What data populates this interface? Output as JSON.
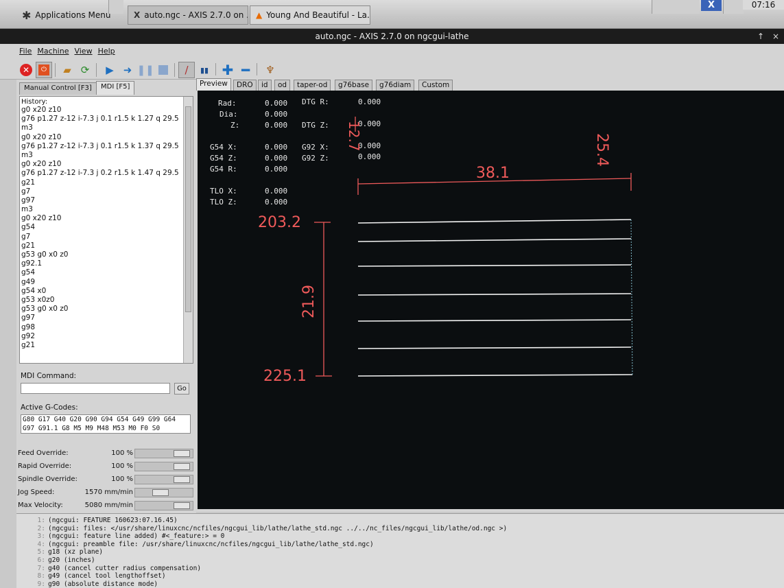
{
  "taskbar": {
    "app_menu": "Applications Menu",
    "tasks": [
      "auto.ngc - AXIS 2.7.0 on ...",
      "Young And Beautiful - La..."
    ],
    "clock": "07:16",
    "tray_badge": "X"
  },
  "window": {
    "title": "auto.ngc - AXIS 2.7.0 on ngcgui-lathe",
    "controls": [
      "↑",
      "×"
    ]
  },
  "menubar": [
    "File",
    "Machine",
    "View",
    "Help"
  ],
  "toolbar_icons": [
    "estop-icon",
    "power-icon",
    "open-icon",
    "reload-icon",
    "run-icon",
    "step-icon",
    "pause-icon",
    "stop-icon",
    "block-delete-icon",
    "optional-stop-icon",
    "zoom-in-icon",
    "zoom-out-icon",
    "clear-plot-icon"
  ],
  "left_tabs": [
    "Manual Control [F3]",
    "MDI [F5]"
  ],
  "history": {
    "title": "History:",
    "items": [
      "g0 x20 z10",
      "g76 p1.27 z-12 i-7.3 j 0.1 r1.5 k 1.27 q 29.5",
      "m3",
      "g0 x20 z10",
      "g76 p1.27 z-12 i-7.3 j 0.1 r1.5 k 1.37 q 29.5",
      "m3",
      "g0 x20 z10",
      "g76 p1.27 z-12 i-7.3 j 0.2 r1.5 k 1.47 q 29.5",
      "g21",
      "g7",
      "g97",
      "m3",
      "g0 x20 z10",
      "g54",
      "g7",
      "g21",
      "g53 g0 x0 z0",
      "g92.1",
      "g54",
      "g49",
      "g54 x0",
      "g53 x0z0",
      "g53 g0 x0 z0",
      "g97",
      "g98",
      "g92",
      "g21"
    ]
  },
  "mdi": {
    "label": "MDI Command:",
    "value": "",
    "go_label": "Go"
  },
  "active_gcodes": {
    "label": "Active G-Codes:",
    "line1": "G80 G17 G40 G20 G90 G94 G54 G49 G99 G64",
    "line2": "G97 G91.1 G8 M5 M9 M48 M53 M0 F0 S0"
  },
  "overrides": {
    "feed": {
      "label": "Feed Override:",
      "value": "100 %",
      "fraction": 1.0
    },
    "rapid": {
      "label": "Rapid Override:",
      "value": "100 %",
      "fraction": 1.0
    },
    "spindle": {
      "label": "Spindle Override:",
      "value": "100 %",
      "fraction": 1.0
    },
    "jog": {
      "label": "Jog Speed:",
      "value": "1570 mm/min",
      "fraction": 0.45
    },
    "max_velocity": {
      "label": "Max Velocity:",
      "value": "5080 mm/min",
      "fraction": 1.0
    }
  },
  "right_tabs": [
    "Preview",
    "DRO",
    "id",
    "od",
    "taper-od",
    "g76base",
    "g76diam",
    "Custom"
  ],
  "dro": {
    "rad": {
      "label": "Rad:",
      "value": "0.000"
    },
    "dia": {
      "label": "Dia:",
      "value": "0.000"
    },
    "z": {
      "label": "Z:",
      "value": "0.000"
    },
    "dtg_r": {
      "label": "DTG R:",
      "value": "0.000"
    },
    "dtg_z": {
      "label": "DTG Z:",
      "value": "0.000"
    },
    "g54_x": {
      "label": "G54 X:",
      "value": "0.000"
    },
    "g54_z": {
      "label": "G54 Z:",
      "value": "0.000"
    },
    "g54_r": {
      "label": "G54 R:",
      "value": "0.000"
    },
    "g92_x": {
      "label": "G92 X:",
      "value": "0.000"
    },
    "g92_z": {
      "label": "G92 Z:",
      "value": "0.000"
    },
    "tlo_x": {
      "label": "TLO X:",
      "value": "0.000"
    },
    "tlo_z": {
      "label": "TLO Z:",
      "value": "0.000"
    }
  },
  "plot_dimensions": {
    "width_top": "38.1",
    "height_right": "25.4",
    "small_vertical": "12.7",
    "top_z": "203.2",
    "bottom_z": "225.1",
    "length": "21.9"
  },
  "colors": {
    "plot_background": "#0b0e10",
    "dimension": "#ef5a5a",
    "toolpath": "#f2f2f2",
    "dro_text": "#e8e8e8"
  },
  "console": [
    {
      "n": "1:",
      "text": "(ngcgui: FEATURE 160623:07.16.45)"
    },
    {
      "n": "2:",
      "text": "(ngcgui: files: </usr/share/linuxcnc/ncfiles/ngcgui_lib/lathe/lathe_std.ngc ../../nc_files/ngcgui_lib/lathe/od.ngc >)"
    },
    {
      "n": "3:",
      "text": "(ngcgui: feature line added) #<_feature:> = 0"
    },
    {
      "n": "4:",
      "text": "(ngcgui: preamble file: /usr/share/linuxcnc/ncfiles/ngcgui_lib/lathe/lathe_std.ngc)"
    },
    {
      "n": "5:",
      "text": "g18 (xz plane)"
    },
    {
      "n": "6:",
      "text": "g20 (inches)"
    },
    {
      "n": "7:",
      "text": "g40 (cancel cutter radius compensation)"
    },
    {
      "n": "8:",
      "text": "g49 (cancel tool lengthoffset)"
    },
    {
      "n": "9:",
      "text": "g90 (absolute distance mode)"
    }
  ]
}
